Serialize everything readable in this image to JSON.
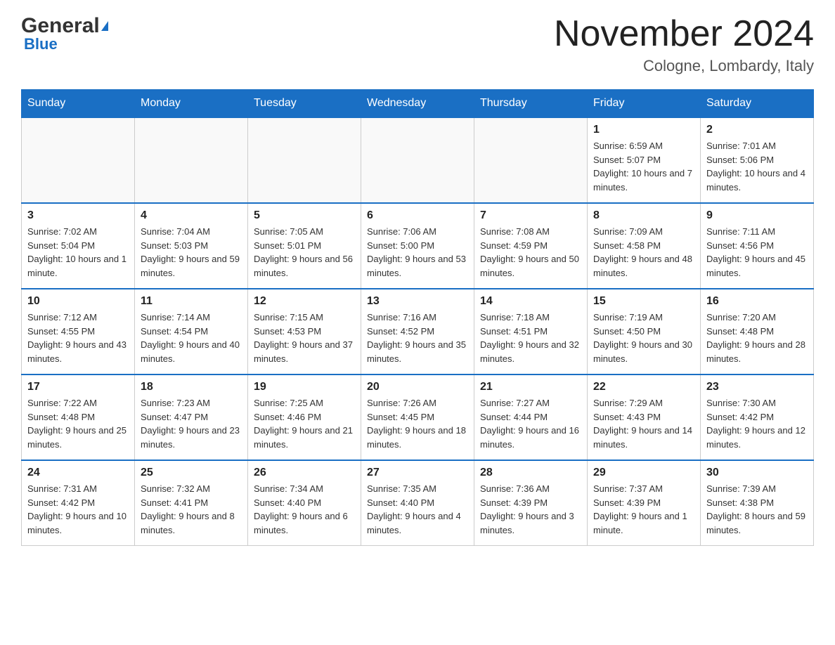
{
  "header": {
    "logo_general": "General",
    "logo_blue": "Blue",
    "month_title": "November 2024",
    "location": "Cologne, Lombardy, Italy"
  },
  "days_of_week": [
    "Sunday",
    "Monday",
    "Tuesday",
    "Wednesday",
    "Thursday",
    "Friday",
    "Saturday"
  ],
  "weeks": [
    [
      {
        "day": "",
        "info": ""
      },
      {
        "day": "",
        "info": ""
      },
      {
        "day": "",
        "info": ""
      },
      {
        "day": "",
        "info": ""
      },
      {
        "day": "",
        "info": ""
      },
      {
        "day": "1",
        "info": "Sunrise: 6:59 AM\nSunset: 5:07 PM\nDaylight: 10 hours and 7 minutes."
      },
      {
        "day": "2",
        "info": "Sunrise: 7:01 AM\nSunset: 5:06 PM\nDaylight: 10 hours and 4 minutes."
      }
    ],
    [
      {
        "day": "3",
        "info": "Sunrise: 7:02 AM\nSunset: 5:04 PM\nDaylight: 10 hours and 1 minute."
      },
      {
        "day": "4",
        "info": "Sunrise: 7:04 AM\nSunset: 5:03 PM\nDaylight: 9 hours and 59 minutes."
      },
      {
        "day": "5",
        "info": "Sunrise: 7:05 AM\nSunset: 5:01 PM\nDaylight: 9 hours and 56 minutes."
      },
      {
        "day": "6",
        "info": "Sunrise: 7:06 AM\nSunset: 5:00 PM\nDaylight: 9 hours and 53 minutes."
      },
      {
        "day": "7",
        "info": "Sunrise: 7:08 AM\nSunset: 4:59 PM\nDaylight: 9 hours and 50 minutes."
      },
      {
        "day": "8",
        "info": "Sunrise: 7:09 AM\nSunset: 4:58 PM\nDaylight: 9 hours and 48 minutes."
      },
      {
        "day": "9",
        "info": "Sunrise: 7:11 AM\nSunset: 4:56 PM\nDaylight: 9 hours and 45 minutes."
      }
    ],
    [
      {
        "day": "10",
        "info": "Sunrise: 7:12 AM\nSunset: 4:55 PM\nDaylight: 9 hours and 43 minutes."
      },
      {
        "day": "11",
        "info": "Sunrise: 7:14 AM\nSunset: 4:54 PM\nDaylight: 9 hours and 40 minutes."
      },
      {
        "day": "12",
        "info": "Sunrise: 7:15 AM\nSunset: 4:53 PM\nDaylight: 9 hours and 37 minutes."
      },
      {
        "day": "13",
        "info": "Sunrise: 7:16 AM\nSunset: 4:52 PM\nDaylight: 9 hours and 35 minutes."
      },
      {
        "day": "14",
        "info": "Sunrise: 7:18 AM\nSunset: 4:51 PM\nDaylight: 9 hours and 32 minutes."
      },
      {
        "day": "15",
        "info": "Sunrise: 7:19 AM\nSunset: 4:50 PM\nDaylight: 9 hours and 30 minutes."
      },
      {
        "day": "16",
        "info": "Sunrise: 7:20 AM\nSunset: 4:48 PM\nDaylight: 9 hours and 28 minutes."
      }
    ],
    [
      {
        "day": "17",
        "info": "Sunrise: 7:22 AM\nSunset: 4:48 PM\nDaylight: 9 hours and 25 minutes."
      },
      {
        "day": "18",
        "info": "Sunrise: 7:23 AM\nSunset: 4:47 PM\nDaylight: 9 hours and 23 minutes."
      },
      {
        "day": "19",
        "info": "Sunrise: 7:25 AM\nSunset: 4:46 PM\nDaylight: 9 hours and 21 minutes."
      },
      {
        "day": "20",
        "info": "Sunrise: 7:26 AM\nSunset: 4:45 PM\nDaylight: 9 hours and 18 minutes."
      },
      {
        "day": "21",
        "info": "Sunrise: 7:27 AM\nSunset: 4:44 PM\nDaylight: 9 hours and 16 minutes."
      },
      {
        "day": "22",
        "info": "Sunrise: 7:29 AM\nSunset: 4:43 PM\nDaylight: 9 hours and 14 minutes."
      },
      {
        "day": "23",
        "info": "Sunrise: 7:30 AM\nSunset: 4:42 PM\nDaylight: 9 hours and 12 minutes."
      }
    ],
    [
      {
        "day": "24",
        "info": "Sunrise: 7:31 AM\nSunset: 4:42 PM\nDaylight: 9 hours and 10 minutes."
      },
      {
        "day": "25",
        "info": "Sunrise: 7:32 AM\nSunset: 4:41 PM\nDaylight: 9 hours and 8 minutes."
      },
      {
        "day": "26",
        "info": "Sunrise: 7:34 AM\nSunset: 4:40 PM\nDaylight: 9 hours and 6 minutes."
      },
      {
        "day": "27",
        "info": "Sunrise: 7:35 AM\nSunset: 4:40 PM\nDaylight: 9 hours and 4 minutes."
      },
      {
        "day": "28",
        "info": "Sunrise: 7:36 AM\nSunset: 4:39 PM\nDaylight: 9 hours and 3 minutes."
      },
      {
        "day": "29",
        "info": "Sunrise: 7:37 AM\nSunset: 4:39 PM\nDaylight: 9 hours and 1 minute."
      },
      {
        "day": "30",
        "info": "Sunrise: 7:39 AM\nSunset: 4:38 PM\nDaylight: 8 hours and 59 minutes."
      }
    ]
  ]
}
